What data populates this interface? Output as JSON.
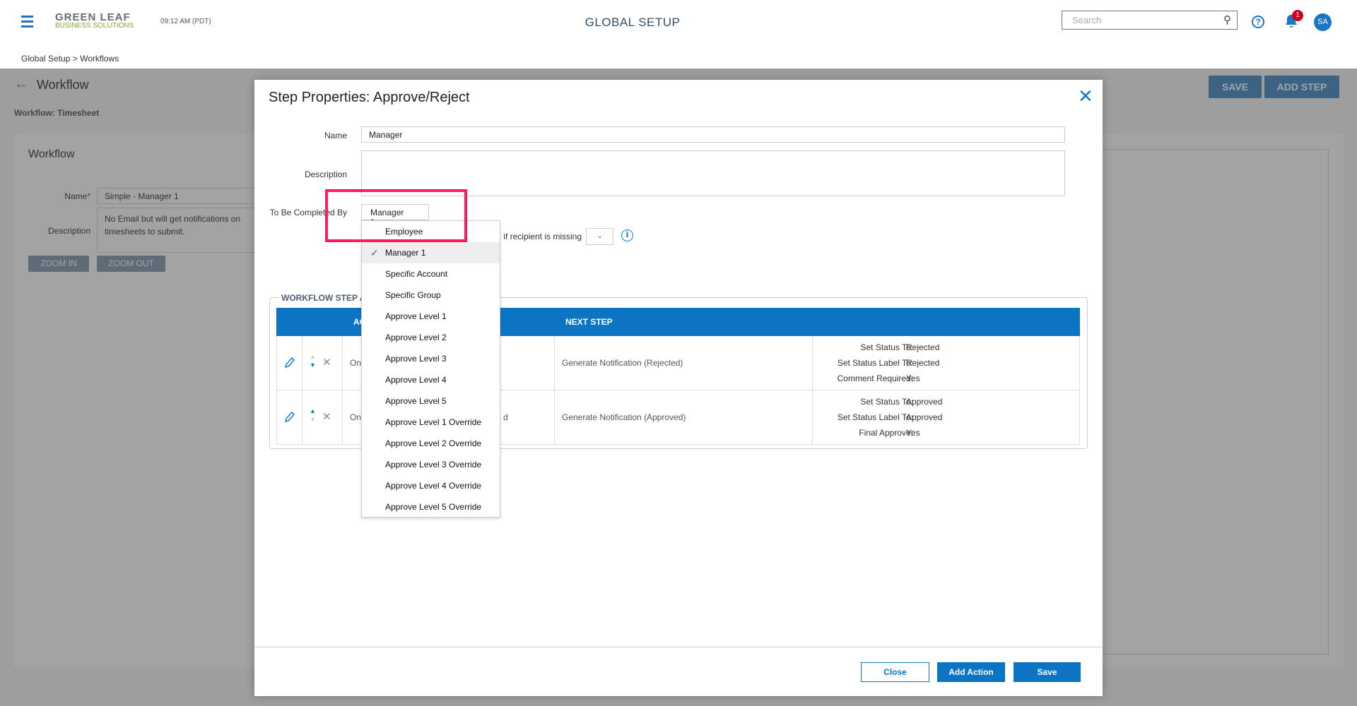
{
  "header": {
    "logo_line1": "GREEN LEAF",
    "logo_line2": "BUSINESS SOLUTIONS",
    "time": "09:12 AM (PDT)",
    "title": "GLOBAL SETUP",
    "search_placeholder": "Search",
    "notification_count": "1",
    "avatar_initials": "SA"
  },
  "breadcrumb": {
    "items": [
      "Global Setup",
      "Workflows"
    ],
    "separator": ">"
  },
  "page": {
    "title": "Workflow",
    "subtitle": "Workflow: Timesheet",
    "save_label": "SAVE",
    "add_step_label": "ADD STEP",
    "panel": {
      "heading": "Workflow",
      "name_label": "Name",
      "required_mark": "*",
      "name_value": "Simple - Manager 1",
      "description_label": "Description",
      "description_value": "No Email but will get notifications on timesheets to submit.",
      "zoom_in": "ZOOM IN",
      "zoom_out": "ZOOM OUT"
    }
  },
  "modal": {
    "title": "Step Properties: Approve/Reject",
    "name_label": "Name",
    "name_value": "Manager",
    "description_label": "Description",
    "description_value": "",
    "completed_by_label": "To Be Completed By",
    "completed_by_value": "Manager 1",
    "options": [
      "Employee",
      "Manager 1",
      "Specific Account",
      "Specific Group",
      "Approve Level 1",
      "Approve Level 2",
      "Approve Level 3",
      "Approve Level 4",
      "Approve Level 5",
      "Approve Level 1 Override",
      "Approve Level 2 Override",
      "Approve Level 3 Override",
      "Approve Level 4 Override",
      "Approve Level 5 Override"
    ],
    "selected_option": "Manager 1",
    "missing_label": "if recipient is missing",
    "missing_value": "",
    "actions_legend": "WORKFLOW STEP AC",
    "table_headers": {
      "action": "AC",
      "next_step": "NEXT STEP"
    },
    "rows": [
      {
        "action": "On",
        "next_step": "Generate Notification (Rejected)",
        "props": [
          {
            "k": "Set Status To:",
            "v": "Rejected"
          },
          {
            "k": "Set Status Label To:",
            "v": "Rejected"
          },
          {
            "k": "Comment Required:",
            "v": "Yes"
          }
        ]
      },
      {
        "action": "On",
        "action_tail": "d",
        "next_step": "Generate Notification (Approved)",
        "props": [
          {
            "k": "Set Status To:",
            "v": "Approved"
          },
          {
            "k": "Set Status Label To:",
            "v": "Approved"
          },
          {
            "k": "Final Approve:",
            "v": "Yes"
          }
        ]
      }
    ],
    "close_label": "Close",
    "add_action_label": "Add Action",
    "save_label": "Save"
  },
  "colors": {
    "accent": "#0b75c4",
    "highlight": "#ff1a5c",
    "overlay": "#9e9e9e",
    "logo_green": "#7fae2e"
  }
}
